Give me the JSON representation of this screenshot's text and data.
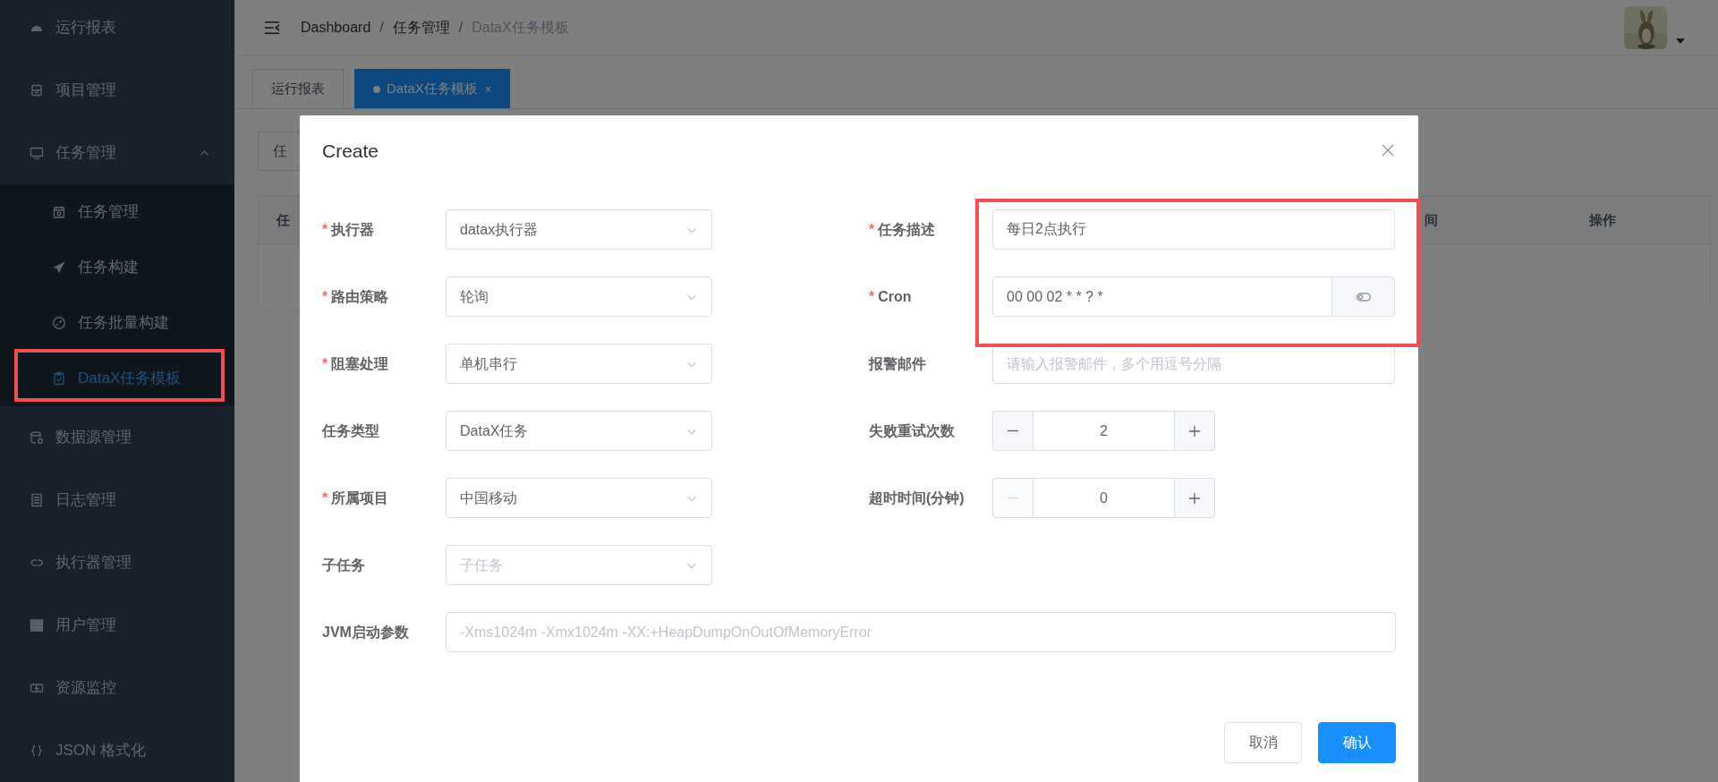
{
  "sidebar": {
    "items": [
      {
        "label": "运行报表",
        "selected": false,
        "highlighted": false
      },
      {
        "label": "项目管理",
        "selected": false,
        "highlighted": false
      },
      {
        "label": "任务管理",
        "selected": false,
        "highlighted": false,
        "expanded": true,
        "children": [
          {
            "label": "任务管理",
            "selected": false,
            "highlighted": false
          },
          {
            "label": "任务构建",
            "selected": false,
            "highlighted": false
          },
          {
            "label": "任务批量构建",
            "selected": false,
            "highlighted": false
          },
          {
            "label": "DataX任务模板",
            "selected": true,
            "highlighted": true
          }
        ]
      },
      {
        "label": "数据源管理",
        "selected": false,
        "highlighted": false
      },
      {
        "label": "日志管理",
        "selected": false,
        "highlighted": false
      },
      {
        "label": "执行器管理",
        "selected": false,
        "highlighted": false
      },
      {
        "label": "用户管理",
        "selected": false,
        "highlighted": false
      },
      {
        "label": "资源监控",
        "selected": false,
        "highlighted": false
      },
      {
        "label": "JSON 格式化",
        "selected": false,
        "highlighted": false
      }
    ]
  },
  "topbar": {
    "breadcrumb": [
      {
        "label": "Dashboard",
        "current": false
      },
      {
        "label": "任务管理",
        "current": false,
        "separator": "/"
      },
      {
        "label": "DataX任务模板",
        "current": true,
        "separator": "/"
      }
    ]
  },
  "tabs": [
    {
      "label": "运行报表",
      "selected": false
    },
    {
      "label": "DataX任务模板",
      "selected": true,
      "close": "×"
    }
  ],
  "background": {
    "search_placeholder": "任",
    "table": {
      "columns": [
        "任",
        "间",
        "操作"
      ]
    }
  },
  "modal": {
    "title": "Create",
    "fields_left": [
      {
        "label": "执行器",
        "mark": "*",
        "kind": "select",
        "value": "datax执行器"
      },
      {
        "label": "路由策略",
        "mark": "*",
        "kind": "select",
        "value": "轮询"
      },
      {
        "label": "阻塞处理",
        "mark": "*",
        "kind": "select",
        "value": "单机串行"
      },
      {
        "label": "任务类型",
        "kind": "select",
        "value": "DataX任务"
      },
      {
        "label": "所属项目",
        "mark": "*",
        "kind": "select",
        "value": "中国移动"
      },
      {
        "label": "子任务",
        "kind": "select",
        "placeholder": "子任务"
      }
    ],
    "fields_right": [
      {
        "label": "任务描述",
        "mark": "*",
        "kind": "text",
        "value": "每日2点执行",
        "highlighted": true
      },
      {
        "label": "Cron",
        "mark": "*",
        "kind": "cron",
        "value": "00 00 02 * * ? *",
        "highlighted": true
      },
      {
        "label": "报警邮件",
        "kind": "text",
        "placeholder": "请输入报警邮件，多个用逗号分隔",
        "highlighted": false
      },
      {
        "label": "失败重试次数",
        "kind": "number",
        "value": "2",
        "minus_disabled": false,
        "highlighted": false
      },
      {
        "label": "超时时间(分钟)",
        "kind": "number",
        "value": "0",
        "minus_disabled": true,
        "highlighted": false
      }
    ],
    "field_wide": {
      "label": "JVM启动参数",
      "kind": "text",
      "placeholder": "-Xms1024m -Xmx1024m -XX:+HeapDumpOnOutOfMemoryError"
    },
    "buttons": [
      {
        "label": "取消",
        "kind": "default"
      },
      {
        "label": "确认",
        "kind": "primary"
      }
    ]
  }
}
